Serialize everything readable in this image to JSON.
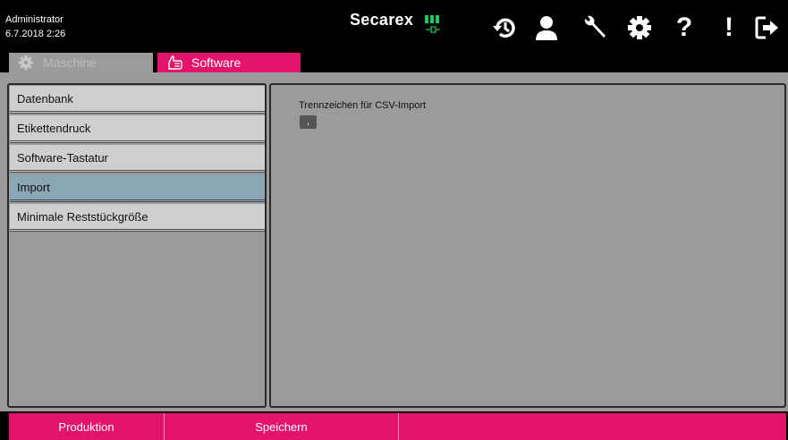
{
  "header": {
    "user": "Administrator",
    "datetime": "6.7.2018 2:26",
    "brand": "Secarex",
    "brand_color": "#ffffff",
    "battery_color": "#22c55e",
    "tools": [
      "history-icon",
      "user-icon",
      "wrench-icon",
      "gear-icon",
      "help-icon",
      "alert-icon",
      "logout-icon"
    ],
    "help_glyph": "?",
    "alert_glyph": "!"
  },
  "tabs": [
    {
      "label": "Maschine",
      "icon": "gear-icon",
      "active": false
    },
    {
      "label": "Software",
      "icon": "hand-pointer-icon",
      "active": true
    }
  ],
  "menu": {
    "items": [
      {
        "label": "Datenbank",
        "active": false
      },
      {
        "label": "Etikettendruck",
        "active": false
      },
      {
        "label": "Software-Tastatur",
        "active": false
      },
      {
        "label": "Import",
        "active": true
      },
      {
        "label": "Minimale Reststückgröße",
        "active": false
      }
    ]
  },
  "settings": {
    "csv_separator_label": "Trennzeichen für CSV-Import",
    "csv_separator_value": ","
  },
  "footer": {
    "production_label": "Produktion",
    "save_label": "Speichern"
  },
  "colors": {
    "accent": "#e3126a",
    "active_item": "#8ba6b5",
    "panel": "#9b9b9b",
    "menu_item": "#cfcfcf"
  }
}
